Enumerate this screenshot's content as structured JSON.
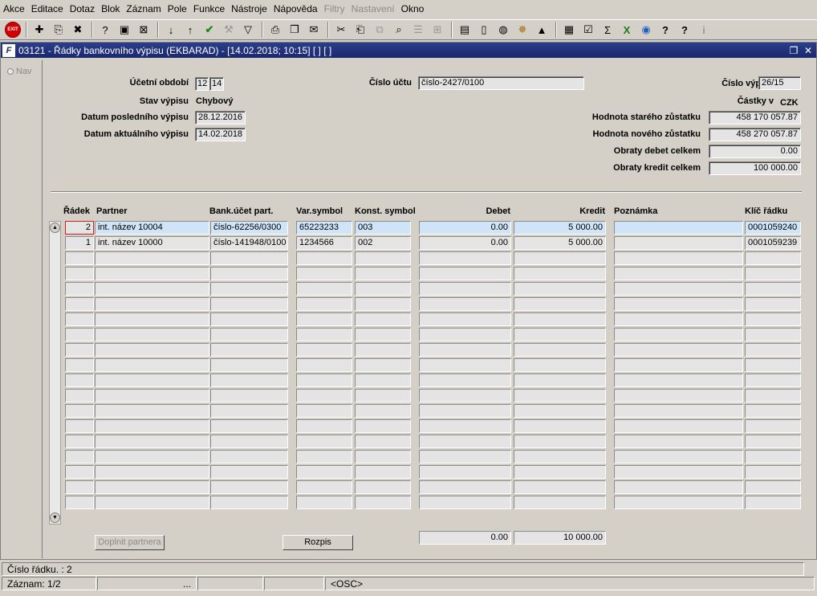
{
  "menu": [
    "Akce",
    "Editace",
    "Dotaz",
    "Blok",
    "Záznam",
    "Pole",
    "Funkce",
    "Nástroje",
    "Nápověda",
    "Filtry",
    "Nastavení",
    "Okno"
  ],
  "menu_disabled": [
    "Filtry",
    "Nastavení"
  ],
  "toolbar": {
    "exit_label": "EXIT"
  },
  "window": {
    "title": "03121 - Řádky bankovního výpisu (EKBARAD) - [14.02.2018; 10:15] [ ] [ ]",
    "nav_label": "Nav"
  },
  "header": {
    "period_label": "Účetní období",
    "period_year": "12",
    "period_month": "14",
    "status_label": "Stav výpisu",
    "status_value": "Chybový",
    "last_date_label": "Datum posledního výpisu",
    "last_date_value": "28.12.2016",
    "current_date_label": "Datum aktuálního výpisu",
    "current_date_value": "14.02.2018",
    "account_label": "Číslo účtu",
    "account_value": "číslo-2427/0100",
    "statement_no_label": "Číslo výpisu",
    "statement_no_value": "26/15",
    "amounts_label": "Částky v",
    "currency": "CZK",
    "old_balance_label": "Hodnota starého zůstatku",
    "old_balance_value": "458 170 057.87",
    "new_balance_label": "Hodnota nového zůstatku",
    "new_balance_value": "458 270 057.87",
    "debit_total_label": "Obraty debet celkem",
    "debit_total_value": "0.00",
    "credit_total_label": "Obraty kredit celkem",
    "credit_total_value": "100 000.00"
  },
  "table": {
    "columns": {
      "radek": "Řádek",
      "partner": "Partner",
      "bank": "Bank.účet part.",
      "var": "Var.symbol",
      "konst": "Konst. symbol",
      "debet": "Debet",
      "kredit": "Kredit",
      "poznamka": "Poznámka",
      "klic": "Klíč řádku"
    },
    "rows": [
      {
        "radek": "2",
        "partner": "int. název 10004",
        "bank": "číslo-62256/0300",
        "var": "65223233",
        "konst": "003",
        "debet": "0.00",
        "kredit": "5 000.00",
        "poznamka": "",
        "klic": "0001059240"
      },
      {
        "radek": "1",
        "partner": "int. název 10000",
        "bank": "číslo-141948/0100",
        "var": "1234566",
        "konst": "002",
        "debet": "0.00",
        "kredit": "5 000.00",
        "poznamka": "",
        "klic": "0001059239"
      }
    ],
    "empty_rows": 17,
    "sum_debet": "0.00",
    "sum_kredit": "10 000.00"
  },
  "buttons": {
    "fill_partner": "Doplnit partnera",
    "breakdown": "Rozpis"
  },
  "status": {
    "line1": "Číslo řádku. : 2",
    "record": "Záznam: 1/2",
    "ellipsis": "...",
    "osc": "<OSC>"
  }
}
